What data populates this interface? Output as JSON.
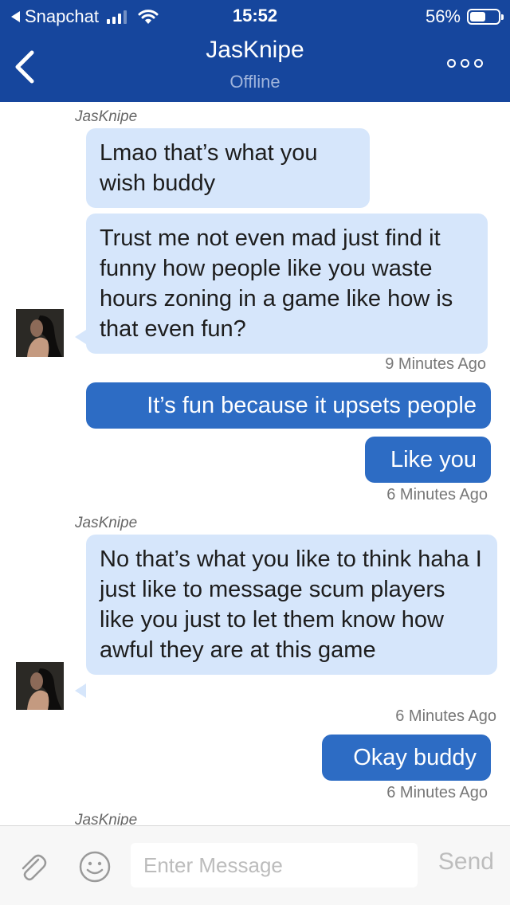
{
  "status_bar": {
    "back_app": "Snapchat",
    "time": "15:52",
    "battery_percent": "56%",
    "battery_level": 0.56,
    "signal_bars": 3,
    "icons": [
      "back-triangle-icon",
      "signal-icon",
      "wifi-icon",
      "battery-icon"
    ]
  },
  "header": {
    "title": "JasKnipe",
    "subtitle": "Offline",
    "icons": [
      "chevron-left-icon",
      "more-options-icon"
    ]
  },
  "messages": [
    {
      "sender": "JasKnipe",
      "direction": "incoming",
      "text": "Lmao that’s what you wish buddy"
    },
    {
      "direction": "incoming",
      "text": "Trust me not even mad just find it funny how people like you waste hours zoning in a game like how is that even fun?",
      "time": "9 Minutes Ago"
    },
    {
      "direction": "outgoing",
      "text": "It’s fun because it upsets people"
    },
    {
      "direction": "outgoing",
      "text": "Like you",
      "time": "6 Minutes Ago"
    },
    {
      "sender": "JasKnipe",
      "direction": "incoming",
      "text": "No that’s what you like to think haha I just like to message scum players like you just to let them know how awful they are at this game",
      "time": "6 Minutes Ago"
    },
    {
      "direction": "outgoing",
      "text": "Okay buddy",
      "time": "6 Minutes Ago"
    },
    {
      "sender": "JasKnipe",
      "direction": "incoming"
    }
  ],
  "composer": {
    "placeholder": "Enter Message",
    "send_label": "Send",
    "icons": [
      "paperclip-icon",
      "emoji-icon"
    ]
  },
  "colors": {
    "header": "#16469d",
    "incoming_bubble": "#d6e6fb",
    "outgoing_bubble": "#2d6cc4"
  }
}
